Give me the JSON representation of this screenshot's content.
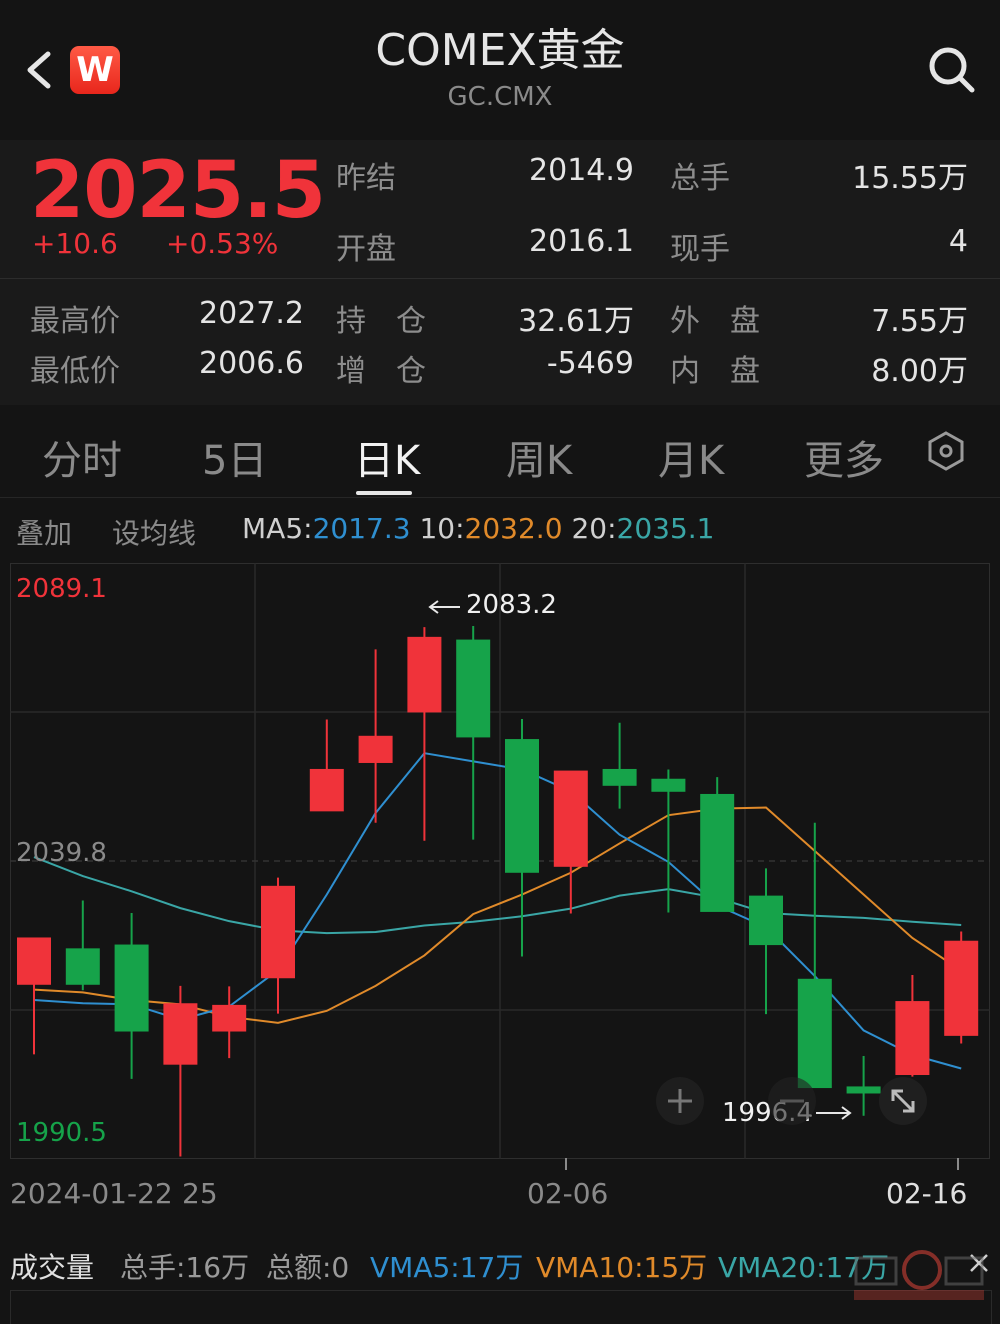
{
  "header": {
    "title": "COMEX黄金",
    "subtitle": "GC.CMX",
    "logo_letter": "W",
    "back_icon": "chevron-left-icon",
    "search_icon": "search-icon"
  },
  "quote": {
    "price": "2025.5",
    "change": "+10.6",
    "change_pct": "+0.53%",
    "fields": [
      {
        "label": "昨结",
        "value": "2014.9"
      },
      {
        "label": "总手",
        "value": "15.55万"
      },
      {
        "label": "开盘",
        "value": "2016.1"
      },
      {
        "label": "现手",
        "value": "4"
      },
      {
        "label": "最高价",
        "value": "2027.2"
      },
      {
        "label": "持　仓",
        "value": "32.61万"
      },
      {
        "label": "外　盘",
        "value": "7.55万"
      },
      {
        "label": "最低价",
        "value": "2006.6"
      },
      {
        "label": "增　仓",
        "value": "-5469"
      },
      {
        "label": "内　盘",
        "value": "8.00万"
      }
    ],
    "colors": {
      "up": "#f0333a",
      "down": "#16a34a"
    }
  },
  "tabs": {
    "items": [
      "分时",
      "5日",
      "日K",
      "周K",
      "月K",
      "更多"
    ],
    "active": "日K",
    "settings_icon": "hexagon-settings-icon"
  },
  "ma_bar": {
    "overlay": "叠加",
    "set_ma": "设均线",
    "ma5_label": "MA5",
    "ma5_value": "2017.3",
    "ma10_label": "10",
    "ma10_value": "2032.0",
    "ma20_label": "20",
    "ma20_value": "2035.1",
    "sep": ":",
    "colors": {
      "ma5": "#2f8fd0",
      "ma10": "#e08a2a",
      "ma20": "#3aa6a6"
    }
  },
  "chart_data": {
    "type": "candlestick",
    "ylim": [
      1990.5,
      2089.1
    ],
    "y_labels": {
      "top": "2089.1",
      "mid": "2039.8",
      "bottom": "1990.5"
    },
    "x_labels": [
      "2024-01-22",
      "25",
      "02-06",
      "02-16"
    ],
    "max_annotation": "2083.2",
    "min_annotation": "1996.4",
    "candles": [
      {
        "o": 2017.4,
        "h": 2025.1,
        "l": 2004.6,
        "c": 2026.1
      },
      {
        "o": 2024.1,
        "h": 2032.9,
        "l": 2016.4,
        "c": 2017.4
      },
      {
        "o": 2024.8,
        "h": 2030.6,
        "l": 2000.1,
        "c": 2008.8
      },
      {
        "o": 2002.7,
        "h": 2017.2,
        "l": 1985.8,
        "c": 2014.0
      },
      {
        "o": 2008.8,
        "h": 2017.1,
        "l": 2003.9,
        "c": 2013.7
      },
      {
        "o": 2018.6,
        "h": 2037.1,
        "l": 2012.1,
        "c": 2035.6
      },
      {
        "o": 2049.3,
        "h": 2066.2,
        "l": 2050.6,
        "c": 2057.1
      },
      {
        "o": 2058.2,
        "h": 2079.1,
        "l": 2047.2,
        "c": 2063.2
      },
      {
        "o": 2067.5,
        "h": 2083.2,
        "l": 2043.9,
        "c": 2081.4
      },
      {
        "o": 2080.9,
        "h": 2083.4,
        "l": 2044.1,
        "c": 2062.9
      },
      {
        "o": 2062.6,
        "h": 2066.3,
        "l": 2022.6,
        "c": 2038.0
      },
      {
        "o": 2039.1,
        "h": 2053.6,
        "l": 2030.5,
        "c": 2056.8
      },
      {
        "o": 2057.1,
        "h": 2065.6,
        "l": 2049.8,
        "c": 2054.0
      },
      {
        "o": 2055.3,
        "h": 2057.0,
        "l": 2030.7,
        "c": 2052.9
      },
      {
        "o": 2052.5,
        "h": 2055.6,
        "l": 2031.6,
        "c": 2030.8
      },
      {
        "o": 2033.8,
        "h": 2038.8,
        "l": 2012.0,
        "c": 2024.7
      },
      {
        "o": 2018.5,
        "h": 2047.2,
        "l": 1998.8,
        "c": 1998.4
      },
      {
        "o": 1998.7,
        "h": 2004.3,
        "l": 1993.3,
        "c": 1997.4
      },
      {
        "o": 2000.8,
        "h": 2019.2,
        "l": 2000.5,
        "c": 2014.4
      },
      {
        "o": 2008.0,
        "h": 2027.2,
        "l": 2006.6,
        "c": 2025.5
      }
    ],
    "ma5": [
      2014.6,
      2014.0,
      2013.8,
      2011.0,
      2013.4,
      2020.1,
      2034.0,
      2049.0,
      2060.0,
      2058.5,
      2057.0,
      2053.0,
      2045.0,
      2040.0,
      2032.0,
      2028.0,
      2019.0,
      2009.0,
      2004.5,
      2002.0
    ],
    "ma10": [
      2016.5,
      2016.0,
      2014.6,
      2013.8,
      2011.5,
      2010.4,
      2012.6,
      2017.2,
      2022.8,
      2030.4,
      2034.0,
      2038.0,
      2043.4,
      2048.6,
      2049.8,
      2050.0,
      2042.0,
      2034.0,
      2026.0,
      2020.0
    ],
    "ma20": [
      2040.9,
      2037.4,
      2034.6,
      2031.5,
      2029.1,
      2027.4,
      2026.9,
      2027.1,
      2028.3,
      2029.0,
      2030.0,
      2031.4,
      2033.8,
      2035.0,
      2033.4,
      2030.6,
      2030.1,
      2029.7,
      2029.0,
      2028.4
    ]
  },
  "volume": {
    "title": "成交量",
    "total_hands": "总手:16万",
    "total_amount": "总额:0",
    "vma5": "VMA5:17万",
    "vma10": "VMA10:15万",
    "vma20": "VMA20:17万"
  }
}
